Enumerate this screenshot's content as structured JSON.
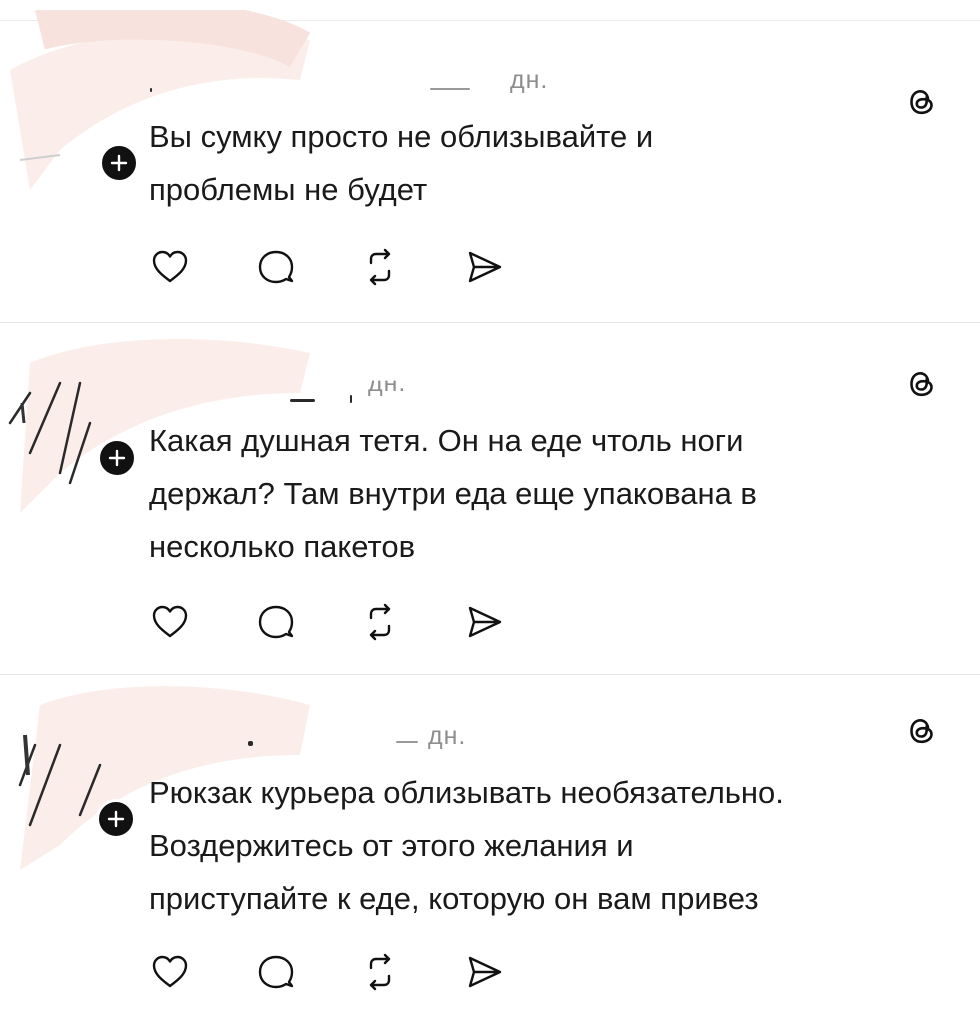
{
  "posts": [
    {
      "time": "дн.",
      "text_lines": [
        "Вы сумку просто не облизывайте и",
        "проблемы не будет"
      ]
    },
    {
      "time": "дн.",
      "text_lines": [
        "Какая душная тетя. Он на еде чтоль ноги",
        "держал? Там внутри еда еще упакована в",
        "несколько пакетов"
      ]
    },
    {
      "time": "дн.",
      "text_lines": [
        "Рюкзак курьера облизывать необязательно.",
        "Воздержитесь от этого желания и",
        "приступайте к еде, которую он вам привез"
      ]
    }
  ],
  "icons": {
    "avatar_badge": "plus-icon",
    "app_logo": "threads-icon",
    "like": "heart-icon",
    "reply": "comment-icon",
    "repost": "repost-icon",
    "share": "send-icon"
  },
  "colors": {
    "text": "#1a1a1a",
    "secondary": "#8e8e8e",
    "divider": "#e6e6e6",
    "badge": "#111111"
  }
}
